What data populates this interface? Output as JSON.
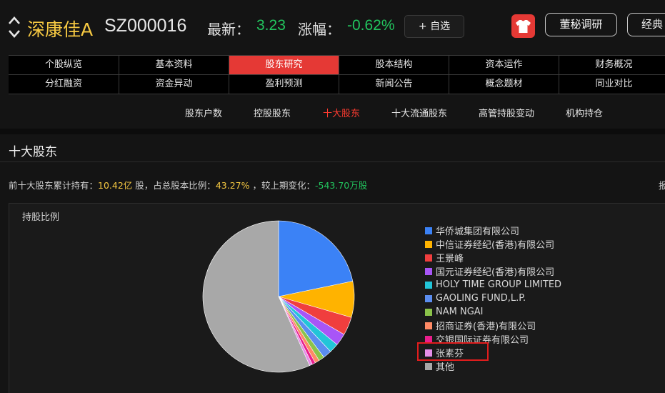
{
  "header": {
    "stock_name": "深康佳A",
    "stock_code": "SZ000016",
    "latest_label": "最新：",
    "latest_value": "3.23",
    "change_label": "涨幅：",
    "change_value": "-0.62%",
    "favorite_button": "+ 自选",
    "secretary_button": "董秘调研",
    "classic_button": "经典"
  },
  "menu": {
    "row1": [
      "个股纵览",
      "基本资料",
      "股东研究",
      "股本结构",
      "资本运作",
      "财务概况"
    ],
    "row2": [
      "分红融资",
      "资金异动",
      "盈利预测",
      "新闻公告",
      "概念题材",
      "同业对比"
    ],
    "active": "股东研究"
  },
  "subnav": {
    "items": [
      "股东户数",
      "控股股东",
      "十大股东",
      "十大流通股东",
      "高管持股变动",
      "机构持仓"
    ],
    "active": "十大股东"
  },
  "section": {
    "title": "十大股东",
    "summary": {
      "prefix": "前十大股东累计持有：",
      "total_shares": "10.42亿",
      "unit_text": "股，占总股本比例：",
      "ratio": "43.27%",
      "change_text": "，较上期变化：",
      "change": "-543.70万股",
      "cut_text": "报"
    }
  },
  "chart_panel": {
    "title": "持股比例"
  },
  "chart_data": {
    "type": "pie",
    "title": "持股比例",
    "slices": [
      {
        "name": "华侨城集团有限公司",
        "value": 21.75,
        "color": "#3b82f6"
      },
      {
        "name": "中信证券经纪(香港)有限公司",
        "value": 7.7,
        "color": "#ffb300"
      },
      {
        "name": "王景峰",
        "value": 3.9,
        "color": "#f03e3e"
      },
      {
        "name": "国元证券经纪(香港)有限公司",
        "value": 2.6,
        "color": "#a855f7"
      },
      {
        "name": "HOLY TIME GROUP LIMITED",
        "value": 2.0,
        "color": "#22c5d8"
      },
      {
        "name": "GAOLING FUND,L.P.",
        "value": 1.85,
        "color": "#5b8def"
      },
      {
        "name": "NAM NGAI",
        "value": 1.2,
        "color": "#8bc34a"
      },
      {
        "name": "招商证券(香港)有限公司",
        "value": 0.95,
        "color": "#ff8a65"
      },
      {
        "name": "交银国际证券有限公司",
        "value": 0.7,
        "color": "#e91e8c"
      },
      {
        "name": "张素芬",
        "value": 0.62,
        "color": "#e58ee8"
      },
      {
        "name": "其他",
        "value": 56.73,
        "color": "#a8a8a8"
      }
    ],
    "highlighted": "张素芬"
  }
}
